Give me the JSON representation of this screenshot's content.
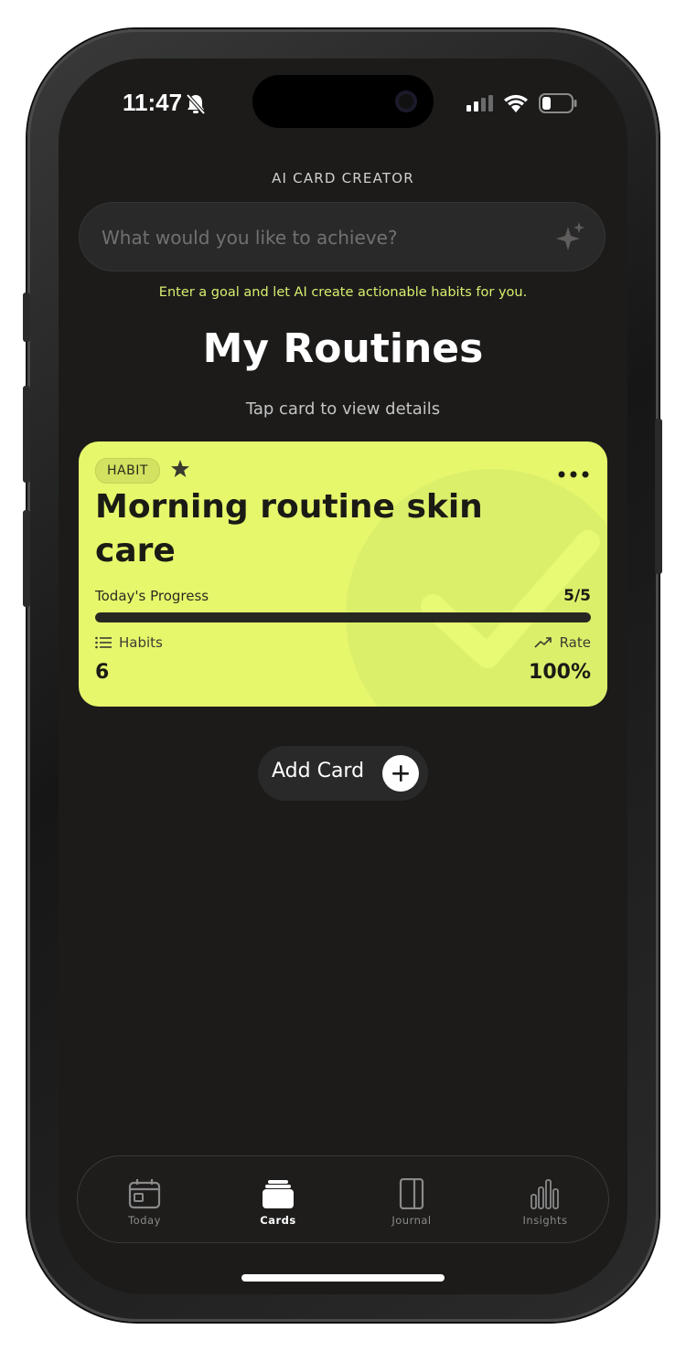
{
  "status": {
    "time": "11:47"
  },
  "ai_creator": {
    "title": "AI CARD CREATOR",
    "placeholder": "What would you like to achieve?",
    "hint": "Enter a goal and let AI create actionable habits for you."
  },
  "page": {
    "title": "My Routines",
    "subtitle": "Tap card to view details"
  },
  "card": {
    "type_label": "HABIT",
    "title": "Morning routine skin care",
    "progress_label": "Today's Progress",
    "progress_text": "5/5",
    "progress_fraction": 1.0,
    "habits_label": "Habits",
    "habits_count": "6",
    "rate_label": "Rate",
    "rate_value": "100%",
    "color": "#e6f76c"
  },
  "add_card": {
    "label": "Add Card"
  },
  "tabs": [
    {
      "label": "Today",
      "icon": "calendar-icon",
      "active": false
    },
    {
      "label": "Cards",
      "icon": "cards-icon",
      "active": true
    },
    {
      "label": "Journal",
      "icon": "journal-icon",
      "active": false
    },
    {
      "label": "Insights",
      "icon": "bar-chart-icon",
      "active": false
    }
  ],
  "colors": {
    "accent": "#d9ef6e",
    "background": "#1c1b1a"
  }
}
